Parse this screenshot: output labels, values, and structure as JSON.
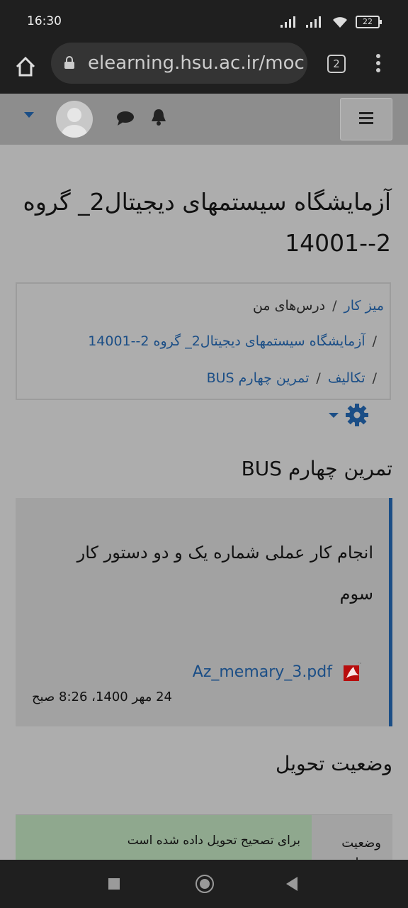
{
  "status_bar": {
    "time": "16:30",
    "battery": "22"
  },
  "browser": {
    "url": "elearning.hsu.ac.ir/moc",
    "tab_count": "2"
  },
  "page": {
    "title": "آزمایشگاه سیستمهای دیجیتال2_ گروه 2--14001",
    "breadcrumb": {
      "dashboard": "میز کار",
      "my_courses": "درس‌های من",
      "course": "آزمایشگاه سیستمهای دیجیتال2_ گروه 2--14001",
      "assignments": "تکالیف",
      "current": "تمرین چهارم BUS",
      "separator": "/"
    },
    "assignment_title": "تمرین چهارم BUS",
    "intro_text": "انجام کار عملی شماره یک و دو دستور کار سوم",
    "attachment": {
      "filename": "Az_memary_3.pdf",
      "date": "24 مهر 1400، 8:26 صبح"
    },
    "submission_status_heading": "وضعیت تحویل",
    "status_table": {
      "label": "وضعیت تحویل",
      "value": "برای تصحیح تحویل داده شده است"
    }
  },
  "colors": {
    "link": "#1b4e86",
    "submitted": "#8fa88e"
  }
}
